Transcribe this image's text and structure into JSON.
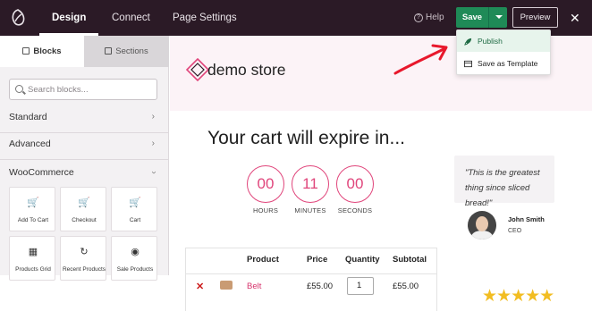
{
  "topbar": {
    "tabs": [
      {
        "label": "Design"
      },
      {
        "label": "Connect"
      },
      {
        "label": "Page Settings"
      }
    ],
    "help_label": "Help",
    "save_label": "Save",
    "preview_label": "Preview",
    "close_glyph": "✕"
  },
  "save_menu": {
    "items": [
      {
        "label": "Publish",
        "icon": "rocket-icon"
      },
      {
        "label": "Save as Template",
        "icon": "template-icon"
      }
    ]
  },
  "sidebar": {
    "tabs": [
      {
        "label": "Blocks"
      },
      {
        "label": "Sections"
      }
    ],
    "search_placeholder": "Search blocks...",
    "categories": [
      {
        "label": "Standard",
        "state": "collapsed"
      },
      {
        "label": "Advanced",
        "state": "collapsed"
      },
      {
        "label": "WooCommerce",
        "state": "expanded"
      }
    ],
    "blocks": [
      {
        "label": "Add To Cart",
        "icon": "cart-plus-icon"
      },
      {
        "label": "Checkout",
        "icon": "cart-arrow-icon"
      },
      {
        "label": "Cart",
        "icon": "cart-icon"
      },
      {
        "label": "Products Grid",
        "icon": "grid-icon"
      },
      {
        "label": "Recent Products",
        "icon": "history-icon"
      },
      {
        "label": "Sale Products",
        "icon": "sale-tag-icon"
      }
    ]
  },
  "page": {
    "brand_text": "demo store",
    "expire_heading": "Your cart will expire in...",
    "timer": [
      {
        "value": "00",
        "label": "HOURS"
      },
      {
        "value": "11",
        "label": "MINUTES"
      },
      {
        "value": "00",
        "label": "SECONDS"
      }
    ],
    "cart_table": {
      "headers": [
        "Product",
        "Price",
        "Quantity",
        "Subtotal"
      ],
      "rows": [
        {
          "remove": "✕",
          "product": "Belt",
          "price": "£55.00",
          "quantity": "1",
          "subtotal": "£55.00"
        }
      ]
    },
    "testimonial": {
      "quote": "\"This is the greatest thing since sliced bread!\"",
      "name": "John Smith",
      "role": "CEO",
      "stars": "★★★★★",
      "rating": 5
    }
  },
  "colors": {
    "topbar_bg": "#2b1a26",
    "save_green": "#1f8a57",
    "accent_pink": "#e0457b",
    "star_gold": "#f2bd22",
    "annotation_arrow": "#e8182c"
  }
}
